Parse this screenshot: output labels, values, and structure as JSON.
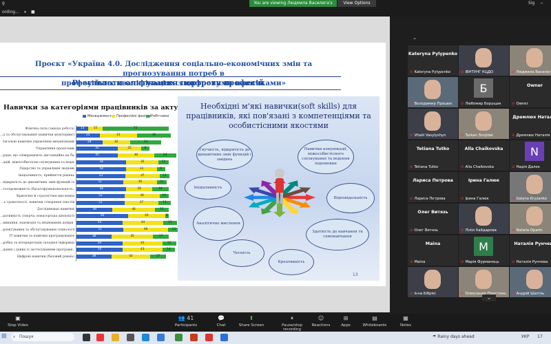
{
  "topbar": {
    "left_label": "g",
    "recording_label": "ording...",
    "share_banner": "You are viewing Людмила Василега's screen",
    "view_options": "View Options",
    "sign": "Sig"
  },
  "slide": {
    "title_line1": "Проєкт «Україна 4.0. Дослідження соціально-економічних змін та прогнозування потреб в",
    "title_line2": "професійних кваліфікаціях з цифровими навичками»",
    "subtitle": "Результати опитування портрету професій",
    "chart_panel_title": "Навички за категоріями працівників за актуальністю",
    "legend": [
      "Менеджмент",
      "Професійні фахівці",
      "Робітники"
    ],
    "soft_title": "Необхідні м'які навички(soft skills) для працівників, які пов'язані з компетенціями та особистісними якостями",
    "soft_skills": [
      "Гнучкість, відкритість до динамічних змін функцій і завдань",
      "Навички комунікації, міжособистісного спілкування та ведення перемовин",
      "Ініціативність",
      "Відповідальність",
      "Аналітичне мислення",
      "Здатність до навчання та самонавчання",
      "Чесність",
      "Креативність"
    ],
    "page_number": "13"
  },
  "chart_data": {
    "type": "bar",
    "stacked": true,
    "orientation": "horizontal",
    "title": "Навички за категоріями працівників за актуальністю",
    "categories": [
      "Фізична сила (завода робота)",
      "...а та обслуговування (навички моніторингу...",
      "Загальні навички управління механізмами",
      "Управління проєктами",
      "...ради, що співпрацюють дистанційно на базі...",
      "...ацій, міжособистісне спілкування та ведення...",
      "Лідерство та управління людьми",
      "Ініціативність, прийняття рішень",
      "...відкритість до динамічних змін функцій та...",
      "...тоспроможність (багатофункціональність...",
      "Критичне й стратегічне мислення",
      "...ь грамотності, навички створення текстів",
      "Дослідницькі навички",
      "...ративність (творча, новаторська діяльність)",
      "...вимання, взаємодія та ініціювання довіри до...",
      "...роектування та обслуговування технологій",
      "ІТ навички та навички програмування",
      "...робка та інтерпретація складної інформації",
      "...даних і даних із застосуванням програмн...",
      "Цифрові навички (базовий рівень)"
    ],
    "series": [
      {
        "name": "Менеджмент",
        "color": "#2e63c7",
        "values": [
          13,
          25,
          28,
          45,
          45,
          54,
          54,
          53,
          51,
          54,
          52,
          52,
          39,
          56,
          50,
          51,
          38,
          50,
          50,
          38
        ]
      },
      {
        "name": "Професійні фахівці",
        "color": "#f2e11b",
        "values": [
          15,
          41,
          30,
          25,
          39,
          35,
          33,
          37,
          36,
          28,
          38,
          37,
          46,
          40,
          44,
          48,
          45,
          43,
          43,
          42
        ]
      },
      {
        "name": "Робітники",
        "color": "#2fa93e",
        "values": [
          72,
          36,
          34,
          9,
          24,
          11,
          9,
          11,
          11,
          18,
          10,
          13,
          15,
          4,
          15,
          13,
          17,
          15,
          14,
          17
        ]
      }
    ],
    "xlim": [
      0,
      100
    ],
    "legend_position": "top"
  },
  "participants": [
    {
      "big": "Kateryna Pylypenko",
      "label": "Kateryna Pylypenko",
      "kind": "name"
    },
    {
      "big": "",
      "label": "ІВНТУНГ КЦДО",
      "kind": "video"
    },
    {
      "big": "",
      "label": "Людмила Василега",
      "kind": "video"
    },
    {
      "big": "",
      "label": "Володимир Процюк",
      "kind": "video"
    },
    {
      "big": "Б",
      "label": "Любомир Борущак",
      "kind": "letter",
      "color": "#6b6b6b"
    },
    {
      "big": "Owner",
      "label": "Owner",
      "kind": "name"
    },
    {
      "big": "",
      "label": "Vitalii Vasylyshyn",
      "kind": "video"
    },
    {
      "big": "",
      "label": "Turkan Shejidai",
      "kind": "video"
    },
    {
      "big": "Дремлюх Наталія",
      "label": "Дремлюх Наталія",
      "kind": "name"
    },
    {
      "big": "Tetiana Tutko",
      "label": "Tetiana Tutko",
      "kind": "name"
    },
    {
      "big": "Alla Chaikovska",
      "label": "Alla Chaikovska",
      "kind": "name"
    },
    {
      "big": "N",
      "label": "Надія Далек",
      "kind": "letter",
      "color": "#6a3fb4"
    },
    {
      "big": "Лариса Петрова",
      "label": "Лариса Петрова",
      "kind": "name"
    },
    {
      "big": "Ірина Галюк",
      "label": "Ірина Галюк",
      "kind": "name"
    },
    {
      "big": "",
      "label": "Galyna Kryzanko",
      "kind": "video"
    },
    {
      "big": "Олег Витязь",
      "label": "Олег Витязь",
      "kind": "name"
    },
    {
      "big": "",
      "label": "Лілія Хайдарова",
      "kind": "video"
    },
    {
      "big": "",
      "label": "Natalia Oparin",
      "kind": "video"
    },
    {
      "big": "Maina",
      "label": "Maina",
      "kind": "name"
    },
    {
      "big": "M",
      "label": "Марія Фурманець",
      "kind": "letter",
      "color": "#2e7d4a"
    },
    {
      "big": "Наталія Рунчева",
      "label": "Наталія Рунчева",
      "kind": "name"
    },
    {
      "big": "",
      "label": "Інна Бібрікі",
      "kind": "video"
    },
    {
      "big": "",
      "label": "Олександр Пристемс...",
      "kind": "video"
    },
    {
      "big": "",
      "label": "Андрій Шатіль",
      "kind": "video"
    }
  ],
  "controls": [
    {
      "icon": "video-off-icon",
      "glyph": "▣",
      "label": "Stop Video"
    },
    {
      "icon": "participants-icon",
      "glyph": "👥",
      "label": "Participants",
      "count": "41"
    },
    {
      "icon": "chat-icon",
      "glyph": "💬",
      "label": "Chat"
    },
    {
      "icon": "share-screen-icon",
      "glyph": "⬆",
      "label": "Share Screen"
    },
    {
      "icon": "recording-icon",
      "glyph": "⏸",
      "label": "Pause/stop recording"
    },
    {
      "icon": "reactions-icon",
      "glyph": "☺",
      "label": "Reactions"
    },
    {
      "icon": "apps-icon",
      "glyph": "⊞",
      "label": "Apps"
    },
    {
      "icon": "whiteboards-icon",
      "glyph": "▤",
      "label": "Whiteboards"
    },
    {
      "icon": "notes-icon",
      "glyph": "▦",
      "label": "Notes"
    }
  ],
  "taskbar": {
    "search_label": "Пошук",
    "weather": "Rainy days ahead",
    "lang": "УКР",
    "time": "17"
  }
}
